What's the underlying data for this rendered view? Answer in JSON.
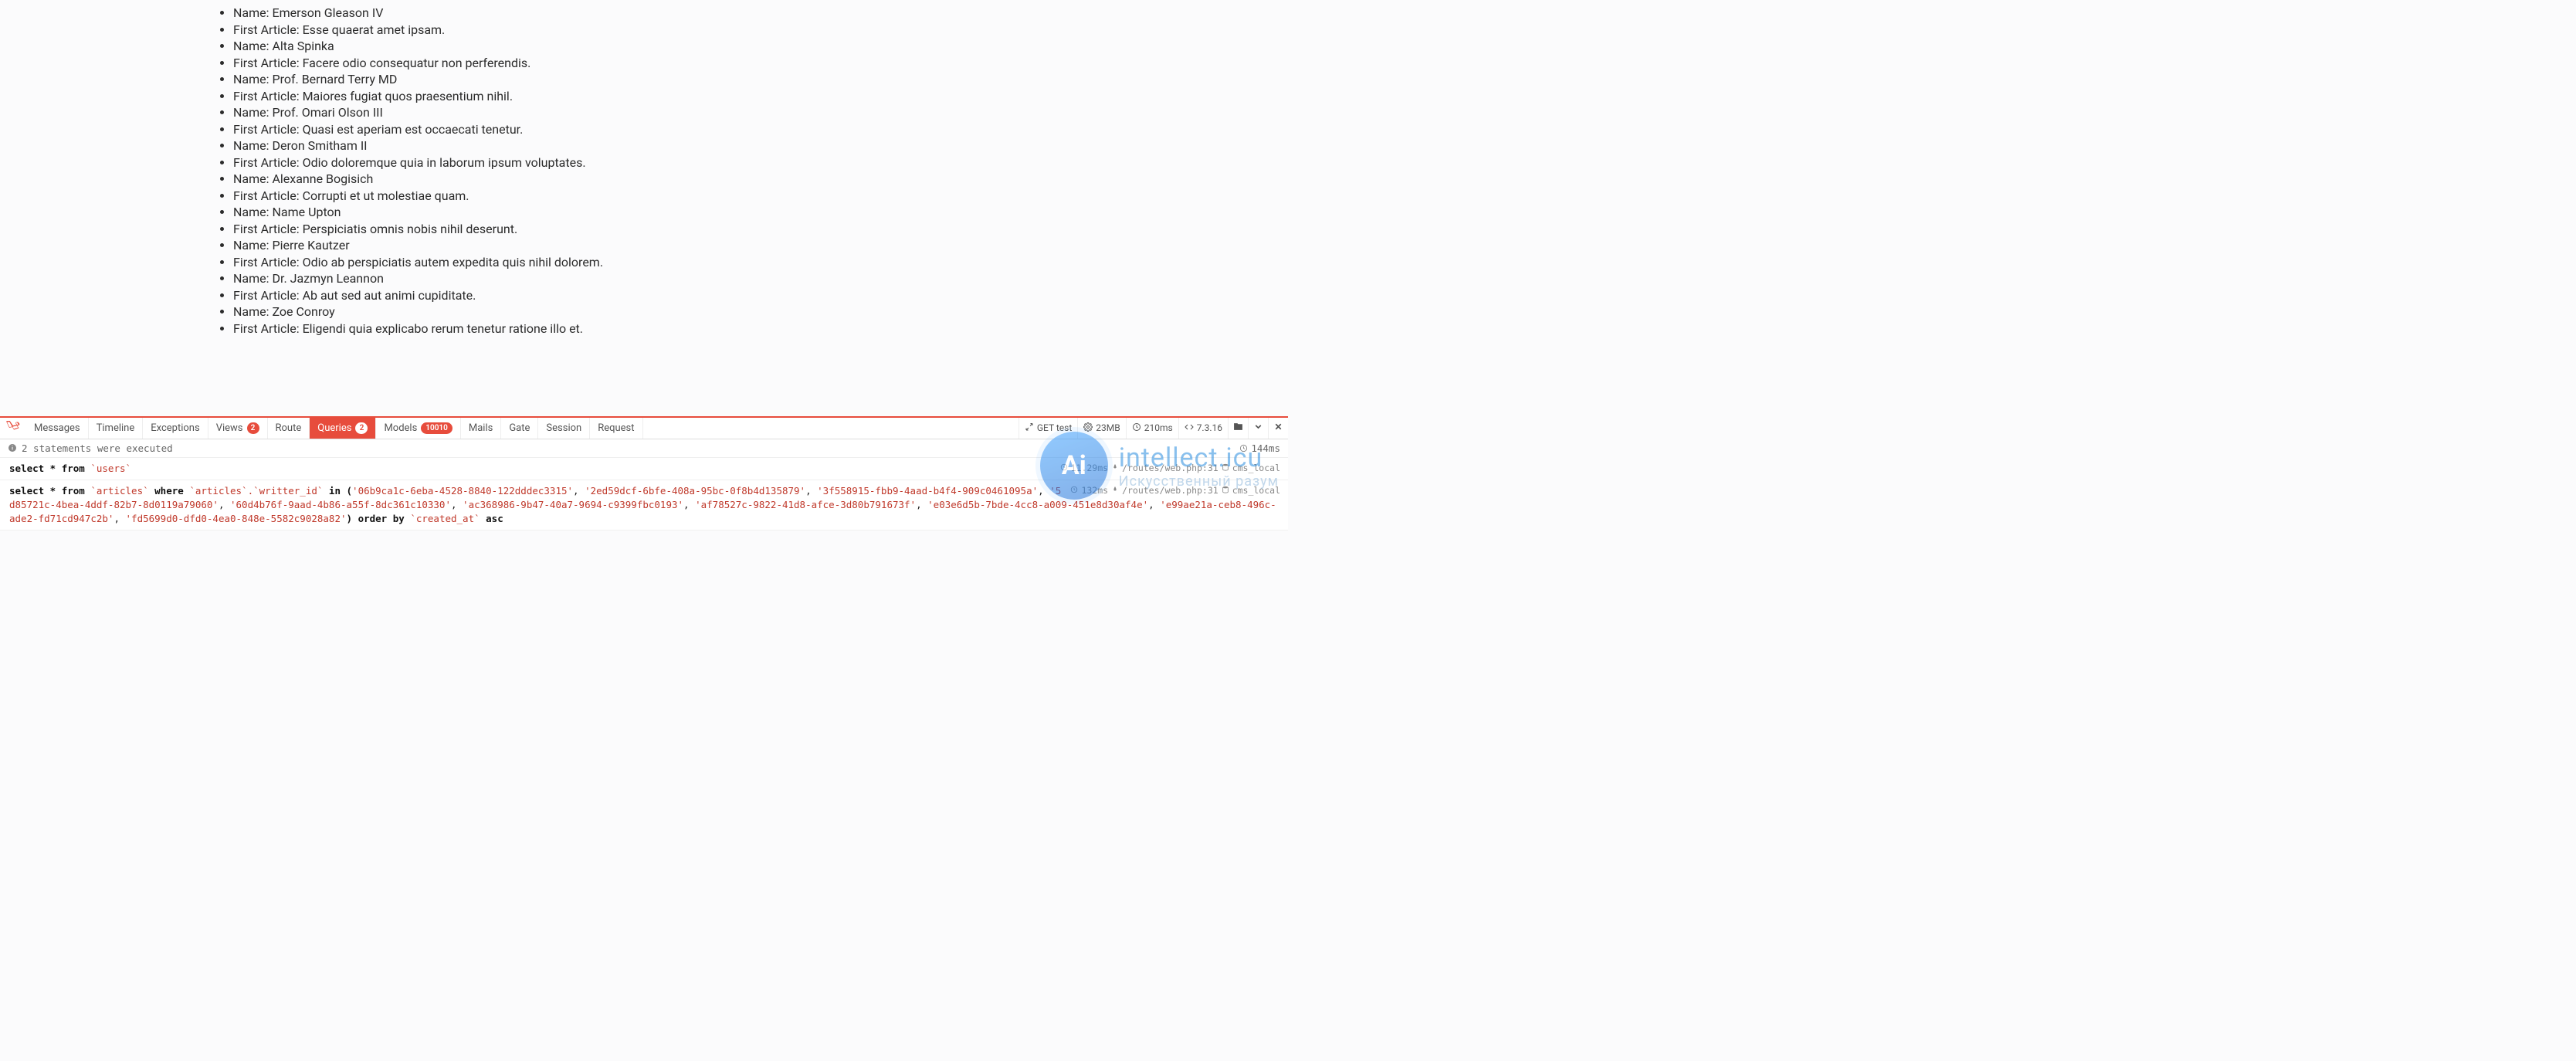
{
  "content": {
    "items": [
      {
        "label": "Name:",
        "value": "Emerson Gleason IV"
      },
      {
        "label": "First Article:",
        "value": "Esse quaerat amet ipsam."
      },
      {
        "label": "Name:",
        "value": "Alta Spinka"
      },
      {
        "label": "First Article:",
        "value": "Facere odio consequatur non perferendis."
      },
      {
        "label": "Name:",
        "value": "Prof. Bernard Terry MD"
      },
      {
        "label": "First Article:",
        "value": "Maiores fugiat quos praesentium nihil."
      },
      {
        "label": "Name:",
        "value": "Prof. Omari Olson III"
      },
      {
        "label": "First Article:",
        "value": "Quasi est aperiam est occaecati tenetur."
      },
      {
        "label": "Name:",
        "value": "Deron Smitham II"
      },
      {
        "label": "First Article:",
        "value": "Odio doloremque quia in laborum ipsum voluptates."
      },
      {
        "label": "Name:",
        "value": "Alexanne Bogisich"
      },
      {
        "label": "First Article:",
        "value": "Corrupti et ut molestiae quam."
      },
      {
        "label": "Name:",
        "value": "Name Upton"
      },
      {
        "label": "First Article:",
        "value": "Perspiciatis omnis nobis nihil deserunt."
      },
      {
        "label": "Name:",
        "value": "Pierre Kautzer"
      },
      {
        "label": "First Article:",
        "value": "Odio ab perspiciatis autem expedita quis nihil dolorem."
      },
      {
        "label": "Name:",
        "value": "Dr. Jazmyn Leannon"
      },
      {
        "label": "First Article:",
        "value": "Ab aut sed aut animi cupiditate."
      },
      {
        "label": "Name:",
        "value": "Zoe Conroy"
      },
      {
        "label": "First Article:",
        "value": "Eligendi quia explicabo rerum tenetur ratione illo et."
      }
    ]
  },
  "debugbar": {
    "tabs": {
      "messages": "Messages",
      "timeline": "Timeline",
      "exceptions": "Exceptions",
      "views": "Views",
      "views_badge": "2",
      "route": "Route",
      "queries": "Queries",
      "queries_badge": "2",
      "models": "Models",
      "models_badge": "10010",
      "mails": "Mails",
      "gate": "Gate",
      "session": "Session",
      "request": "Request"
    },
    "right": {
      "method_route": "GET test",
      "memory": "23MB",
      "time": "210ms",
      "php_version": "7.3.16"
    },
    "panel": {
      "header_text": "2 statements were executed",
      "header_time": "144ms",
      "queries": [
        {
          "time": "11.29ms",
          "location": "/routes/web.php:31",
          "db": "cms_local",
          "sql_prefix": "select * from ",
          "sql_table": "`users`"
        },
        {
          "time": "132ms",
          "location": "/routes/web.php:31",
          "db": "cms_local",
          "sql_prefix": "select * from ",
          "sql_table": "`articles`",
          "sql_where": " where ",
          "sql_col": "`articles`.`writter_id`",
          "sql_in": " in (",
          "ids": [
            "'06b9ca1c-6eba-4528-8840-122dddec3315'",
            "'2ed59dcf-6bfe-408a-95bc-0f8b4d135879'",
            "'3f558915-fbb9-4aad-b4f4-909c0461095a'",
            "'5d85721c-4bea-4ddf-82b7-8d0119a79060'",
            "'60d4b76f-9aad-4b86-a55f-8dc361c10330'",
            "'ac368986-9b47-40a7-9694-c9399fbc0193'",
            "'af78527c-9822-41d8-afce-3d80b791673f'",
            "'e03e6d5b-7bde-4cc8-a009-451e8d30af4e'",
            "'e99ae21a-ceb8-496c-ade2-fd71cd947c2b'",
            "'fd5699d0-dfd0-4ea0-848e-5582c9028a82'"
          ],
          "sql_close": ") ",
          "sql_order": "order by ",
          "sql_order_col": "`created_at`",
          "sql_order_dir": " asc"
        }
      ]
    }
  },
  "watermark": {
    "badge": "Ai",
    "line1": "intellect.icu",
    "line2": "Искусственный разум"
  }
}
